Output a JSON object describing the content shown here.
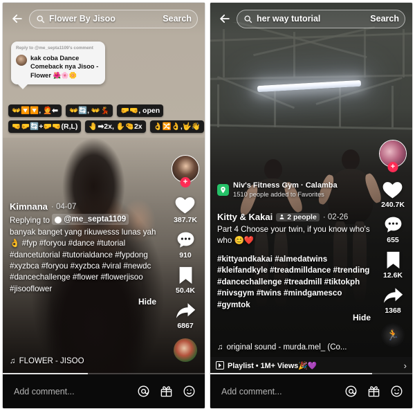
{
  "left_panel": {
    "search": {
      "value": "Flower By Jisoo",
      "placeholder": "Search",
      "search_label": "Search",
      "back_icon": "back-arrow-icon",
      "icon": "search-icon"
    },
    "reply_bubble": {
      "meta": "Reply to @me_septa1109's comment",
      "text": "kak coba Dance Comeback nya Jisoo - Flower 🌺🌸🌼"
    },
    "sticker_chips": [
      [
        "👐🔽🔽, 🧑‍🦰⬅",
        "👐🔄, 👐💃",
        "🤛🤜, open"
      ],
      [
        "🤜🤛🔄+🤛🤜(R,L)",
        "🤚➡2x, ✋🤏2x",
        "👌🔀👌,🤟👋"
      ]
    ],
    "author": "Kimnana",
    "date": "04-07",
    "caption_prefix": "Replying to",
    "reply_to_user": "@me_septa1109",
    "caption_body": "banyak banget yang rikuwesss lunas yah👌 #fyp #foryou #dance #tutorial #dancetutorial #tutorialdance #fypdong #xyzbca #foryou #xyzbca #viral #newdc #dancechallenge #flower #flowerjisoo #jisooflower",
    "hide_label": "Hide",
    "music": "FLOWER - JISOO",
    "music_icon": "music-note-icon",
    "rail": {
      "avatar_name": "profile-avatar",
      "follow_badge": "+",
      "like_count": "387.7K",
      "comment_count": "910",
      "bookmark_count": "50.4K",
      "share_count": "6867"
    },
    "comment_bar": {
      "placeholder": "Add comment...",
      "icons": [
        "mention-icon",
        "gift-icon",
        "emoji-icon"
      ]
    }
  },
  "right_panel": {
    "search": {
      "value": "her way tutorial",
      "placeholder": "Search",
      "search_label": "Search",
      "back_icon": "back-arrow-icon",
      "icon": "search-icon"
    },
    "location": {
      "name": "Niv's Fitness Gym · Calamba",
      "subtitle": "1510 people added to Favorites",
      "icon": "location-pin-icon"
    },
    "author": "Kitty & Kakai",
    "people_pill": "2 people",
    "date": "02-26",
    "caption_body": "Part 4  Choose your twin, if you know who's who 😊❤️",
    "caption_tags": "#kittyandkakai #almedatwins #kleifandkyle #treadmilldance #trending #dancechallenge #treadmill #tiktokph #nivsgym #twins #mindgamesco #gymtok",
    "hide_label": "Hide",
    "music": "original sound - murda.mel_ (Co...",
    "music_icon": "music-note-icon",
    "playlist": {
      "text": "Playlist • 1M+ Views🎉💜",
      "icon": "playlist-icon",
      "chevron": "›"
    },
    "rail": {
      "avatar_name": "profile-avatar",
      "follow_badge": "+",
      "like_count": "240.7K",
      "comment_count": "655",
      "bookmark_count": "12.6K",
      "share_count": "1368"
    },
    "comment_bar": {
      "placeholder": "Add comment...",
      "icons": [
        "mention-icon",
        "gift-icon",
        "emoji-icon"
      ]
    }
  },
  "colors": {
    "accent": "#fe2c55",
    "location_green": "#25c268",
    "bar_black": "#0a0a0a"
  }
}
